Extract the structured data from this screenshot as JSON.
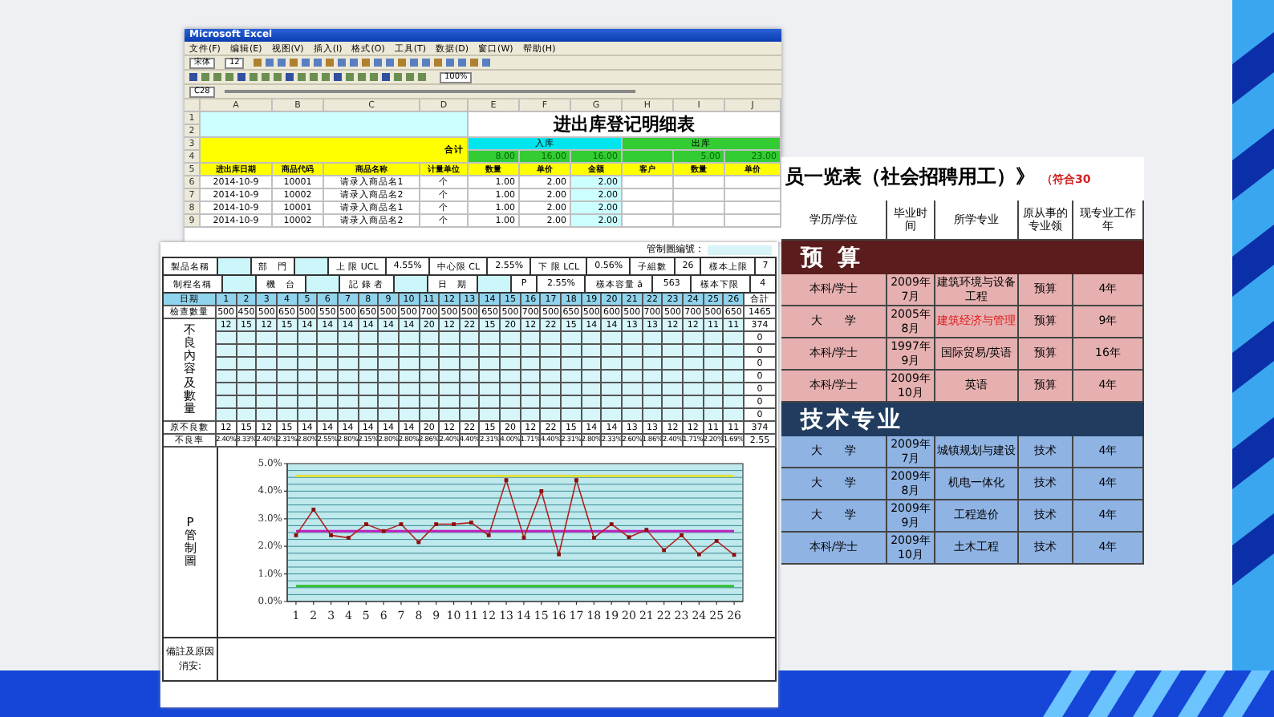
{
  "excel_window": {
    "title": "Microsoft Excel",
    "menus": [
      "文件(F)",
      "编辑(E)",
      "视图(V)",
      "插入(I)",
      "格式(O)",
      "工具(T)",
      "数据(D)",
      "窗口(W)",
      "帮助(H)"
    ],
    "font_name": "宋体",
    "font_size": "12",
    "zoom": "100%",
    "name_box": "C28",
    "columns": [
      "A",
      "B",
      "C",
      "D",
      "E",
      "F",
      "G",
      "H",
      "I",
      "J"
    ],
    "sheet_title": "进出库登记明细表",
    "total_label": "合计",
    "in_label": "入库",
    "out_label": "出库",
    "row_numbers": [
      "1",
      "2",
      "3",
      "4",
      "5"
    ],
    "in_totals": [
      "8.00",
      "16.00",
      "16.00"
    ],
    "out_totals": [
      "5.00",
      "23.00"
    ],
    "headers": [
      "进出库日期",
      "商品代码",
      "商品名称",
      "计量单位",
      "数量",
      "单价",
      "金额",
      "客户",
      "数量",
      "单价"
    ],
    "rows": [
      {
        "row": "6",
        "cells": [
          "2014-10-9",
          "10001",
          "请录入商品名1",
          "个",
          "1.00",
          "2.00",
          "2.00"
        ]
      },
      {
        "row": "7",
        "cells": [
          "2014-10-9",
          "10002",
          "请录入商品名2",
          "个",
          "1.00",
          "2.00",
          "2.00"
        ]
      },
      {
        "row": "8",
        "cells": [
          "2014-10-9",
          "10001",
          "请录入商品名1",
          "个",
          "1.00",
          "2.00",
          "2.00"
        ]
      },
      {
        "row": "9",
        "cells": [
          "2014-10-9",
          "10002",
          "请录入商品名2",
          "个",
          "1.00",
          "2.00",
          "2.00"
        ]
      }
    ]
  },
  "roster_window": {
    "title": "员一览表（社会招聘用工）》",
    "note": "（符合30",
    "headers": [
      "学历/学位",
      "毕业时间",
      "所学专业",
      "原从事的专业领",
      "现专业工作年"
    ],
    "sections": [
      {
        "name": "预 算",
        "kind": "budget",
        "rows": [
          {
            "cells": [
              "本科/学士",
              "2009年7月",
              "建筑环境与设备工程",
              "预算",
              "4年"
            ],
            "alert": false
          },
          {
            "cells": [
              "大　　学",
              "2005年8月",
              "建筑经济与管理",
              "预算",
              "9年"
            ],
            "alert": true
          },
          {
            "cells": [
              "本科/学士",
              "1997年9月",
              "国际贸易/英语",
              "预算",
              "16年"
            ],
            "alert": false
          },
          {
            "cells": [
              "本科/学士",
              "2009年10月",
              "英语",
              "预算",
              "4年"
            ],
            "alert": false
          }
        ]
      },
      {
        "name": "技术专业",
        "kind": "tech",
        "rows": [
          {
            "cells": [
              "大　　学",
              "2009年7月",
              "城镇规划与建设",
              "技术",
              "4年"
            ],
            "alert": false
          },
          {
            "cells": [
              "大　　学",
              "2009年8月",
              "机电一体化",
              "技术",
              "4年"
            ],
            "alert": false
          },
          {
            "cells": [
              "大　　学",
              "2009年9月",
              "工程造价",
              "技术",
              "4年"
            ],
            "alert": false
          },
          {
            "cells": [
              "本科/学士",
              "2009年10月",
              "土木工程",
              "技术",
              "4年"
            ],
            "alert": false
          }
        ]
      }
    ]
  },
  "pchart_window": {
    "chart_no_label": "管制圖編號：",
    "info_rows": [
      [
        {
          "kind": "label",
          "text": "製品名稱"
        },
        {
          "kind": "input"
        },
        {
          "kind": "label",
          "text": "部　門"
        },
        {
          "kind": "input"
        },
        {
          "kind": "label",
          "text": "上 限 UCL"
        },
        {
          "kind": "value",
          "text": "4.55%"
        },
        {
          "kind": "label",
          "text": "中心限 CL"
        },
        {
          "kind": "value",
          "text": "2.55%"
        },
        {
          "kind": "label",
          "text": "下 限 LCL"
        },
        {
          "kind": "value",
          "text": "0.56%"
        },
        {
          "kind": "label",
          "text": "子組數"
        },
        {
          "kind": "value",
          "text": "26"
        },
        {
          "kind": "label",
          "text": "樣本上限"
        },
        {
          "kind": "value",
          "text": "7"
        }
      ],
      [
        {
          "kind": "label",
          "text": "制程名稱"
        },
        {
          "kind": "input"
        },
        {
          "kind": "label",
          "text": "機　台"
        },
        {
          "kind": "input"
        },
        {
          "kind": "label",
          "text": "記 錄 者"
        },
        {
          "kind": "input"
        },
        {
          "kind": "label",
          "text": "日　期"
        },
        {
          "kind": "input"
        },
        {
          "kind": "label",
          "text": "P"
        },
        {
          "kind": "value",
          "text": "2.55%"
        },
        {
          "kind": "label",
          "text": "樣本容量 ā"
        },
        {
          "kind": "value",
          "text": "563"
        },
        {
          "kind": "label",
          "text": "樣本下限"
        },
        {
          "kind": "value",
          "text": "4"
        }
      ]
    ],
    "date_label": "日期",
    "days": [
      "1",
      "2",
      "3",
      "4",
      "5",
      "6",
      "7",
      "8",
      "9",
      "10",
      "11",
      "12",
      "13",
      "14",
      "15",
      "16",
      "17",
      "18",
      "19",
      "20",
      "21",
      "22",
      "23",
      "24",
      "25",
      "26"
    ],
    "total_label": "合計",
    "inspect_label": "檢查數量",
    "inspected": [
      "500",
      "450",
      "500",
      "650",
      "500",
      "550",
      "500",
      "650",
      "500",
      "500",
      "700",
      "500",
      "500",
      "650",
      "500",
      "700",
      "500",
      "650",
      "500",
      "600",
      "500",
      "700",
      "500",
      "700",
      "500",
      "650"
    ],
    "inspected_total": "1465",
    "defect_label": "不良內容及數量",
    "defects": [
      "12",
      "15",
      "12",
      "15",
      "14",
      "14",
      "14",
      "14",
      "14",
      "14",
      "20",
      "12",
      "22",
      "15",
      "20",
      "12",
      "22",
      "15",
      "14",
      "14",
      "13",
      "13",
      "12",
      "12",
      "11",
      "11"
    ],
    "defects_total": "374",
    "blank_totals": [
      "0",
      "0",
      "0",
      "0",
      "0",
      "0",
      "0"
    ],
    "count_label": "原不良數",
    "counts": [
      "12",
      "15",
      "12",
      "15",
      "14",
      "14",
      "14",
      "14",
      "14",
      "14",
      "20",
      "12",
      "22",
      "15",
      "20",
      "12",
      "22",
      "15",
      "14",
      "14",
      "13",
      "13",
      "12",
      "12",
      "11",
      "11"
    ],
    "counts_total": "374",
    "rate_label": "不良率",
    "rates": [
      "2.40%",
      "3.33%",
      "2.40%",
      "2.31%",
      "2.80%",
      "2.55%",
      "2.80%",
      "2.15%",
      "2.80%",
      "2.80%",
      "2.86%",
      "2.40%",
      "4.40%",
      "2.31%",
      "4.00%",
      "1.71%",
      "4.40%",
      "2.31%",
      "2.80%",
      "2.33%",
      "2.60%",
      "1.86%",
      "2.40%",
      "1.71%",
      "2.20%",
      "1.69%"
    ],
    "rate_total": "2.55",
    "chart_label": "P管制圖",
    "chart_data": {
      "type": "line",
      "grid": true,
      "xlim": [
        0.5,
        26.5
      ],
      "x": [
        1,
        2,
        3,
        4,
        5,
        6,
        7,
        8,
        9,
        10,
        11,
        12,
        13,
        14,
        15,
        16,
        17,
        18,
        19,
        20,
        21,
        22,
        23,
        24,
        25,
        26
      ],
      "ylim": [
        0,
        5
      ],
      "xticks": [
        1,
        2,
        3,
        4,
        5,
        6,
        7,
        8,
        9,
        10,
        11,
        12,
        13,
        14,
        15,
        16,
        17,
        18,
        19,
        20,
        21,
        22,
        23,
        24,
        25,
        26
      ],
      "yticks": [
        {
          "value": 0,
          "label": "0.0%"
        },
        {
          "value": 1,
          "label": "1.0%"
        },
        {
          "value": 2,
          "label": "2.0%"
        },
        {
          "value": 3,
          "label": "3.0%"
        },
        {
          "value": 4,
          "label": "4.0%"
        },
        {
          "value": 5,
          "label": "5.0%"
        }
      ],
      "series": [
        {
          "color": "#b02020",
          "values": [
            2.4,
            3.33,
            2.4,
            2.31,
            2.8,
            2.55,
            2.8,
            2.15,
            2.8,
            2.8,
            2.86,
            2.4,
            4.4,
            2.31,
            4.0,
            1.71,
            4.4,
            2.31,
            2.8,
            2.33,
            2.6,
            1.86,
            2.4,
            1.71,
            2.2,
            1.69
          ]
        },
        {
          "color": "#e0e040",
          "values": [
            4.55,
            4.55,
            4.55,
            4.55,
            4.55,
            4.55,
            4.55,
            4.55,
            4.55,
            4.55,
            4.55,
            4.55,
            4.55,
            4.55,
            4.55,
            4.55,
            4.55,
            4.55,
            4.55,
            4.55,
            4.55,
            4.55,
            4.55,
            4.55,
            4.55,
            4.55
          ]
        },
        {
          "color": "#c020c0",
          "values": [
            2.55,
            2.55,
            2.55,
            2.55,
            2.55,
            2.55,
            2.55,
            2.55,
            2.55,
            2.55,
            2.55,
            2.55,
            2.55,
            2.55,
            2.55,
            2.55,
            2.55,
            2.55,
            2.55,
            2.55,
            2.55,
            2.55,
            2.55,
            2.55,
            2.55,
            2.55
          ]
        },
        {
          "color": "#30c030",
          "values": [
            0.56,
            0.56,
            0.56,
            0.56,
            0.56,
            0.56,
            0.56,
            0.56,
            0.56,
            0.56,
            0.56,
            0.56,
            0.56,
            0.56,
            0.56,
            0.56,
            0.56,
            0.56,
            0.56,
            0.56,
            0.56,
            0.56,
            0.56,
            0.56,
            0.56,
            0.56
          ]
        }
      ]
    },
    "note_label": "備註及原因消安:"
  }
}
